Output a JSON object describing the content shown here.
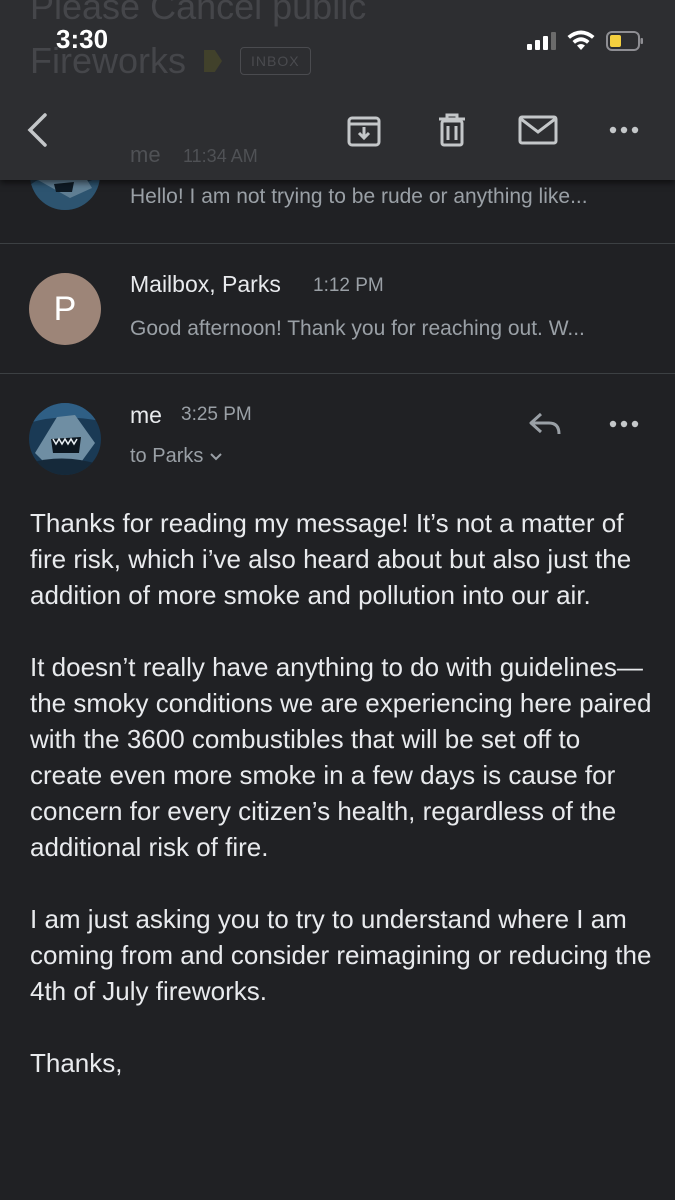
{
  "subject": {
    "line1": "Please Cancel public",
    "line2": "Fireworks",
    "label": "INBOX"
  },
  "status_bar": {
    "time": "3:30"
  },
  "thread": [
    {
      "sender": "me",
      "time": "11:34 AM",
      "preview": "Hello! I am not trying to be rude or anything like..."
    },
    {
      "sender": "Mailbox, Parks",
      "initial": "P",
      "time": "1:12 PM",
      "preview": "Good afternoon! Thank you for reaching out. W..."
    }
  ],
  "message": {
    "sender": "me",
    "time": "3:25 PM",
    "to": "to Parks",
    "paragraphs": [
      "Thanks for reading my message! It’s not a matter of fire risk, which i’ve also heard about but also just the addition of more smoke and pollution into our air.",
      "It doesn’t really have anything to do with guidelines— the smoky conditions we are experiencing here paired with the 3600 combustibles that will be set off to create even more smoke in a few days is cause for concern for every citizen’s health, regardless of the additional risk of fire.",
      "I am just asking you to try to understand where I am coming from and consider reimagining or reducing the 4th of July fireworks.",
      "Thanks,"
    ]
  },
  "colors": {
    "background": "#202124",
    "avatar_p": "#9d8578",
    "battery": "#f4d03f"
  }
}
